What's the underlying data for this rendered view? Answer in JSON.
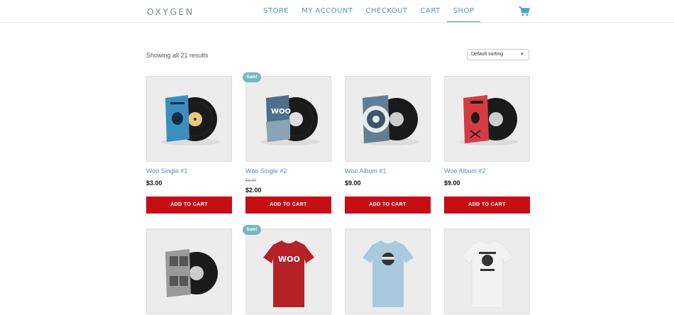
{
  "header": {
    "logo": "OXYGEN",
    "nav": [
      "STORE",
      "MY ACCOUNT",
      "CHECKOUT",
      "CART",
      "SHOP"
    ],
    "active_nav": "SHOP",
    "cart_icon": "shopping-cart-icon"
  },
  "shop": {
    "result_count": "Showing all 21 results",
    "sorting": {
      "selected": "Default sorting",
      "caret": "▼"
    }
  },
  "products": [
    {
      "name": "Woo Single #1",
      "price": "$3.00",
      "button": "ADD TO CART",
      "image": "vinyl-record-blue"
    },
    {
      "name": "Woo Single #2",
      "sale_badge": "Sale!",
      "old_price": "$3.00",
      "price": "$2.00",
      "button": "ADD TO CART",
      "image": "vinyl-record-woo"
    },
    {
      "name": "Woo Album #1",
      "price": "$9.00",
      "button": "ADD TO CART",
      "image": "vinyl-record-circle"
    },
    {
      "name": "Woo Album #2",
      "price": "$9.00",
      "button": "ADD TO CART",
      "image": "vinyl-record-red"
    },
    {
      "name": "",
      "image": "vinyl-record-gray"
    },
    {
      "name": "",
      "sale_badge": "Sale!",
      "image": "tshirt-red-woo"
    },
    {
      "name": "",
      "image": "tshirt-blue-ninja"
    },
    {
      "name": "",
      "image": "tshirt-white-woothemes"
    }
  ],
  "colors": {
    "accent": "#5a8fb0",
    "button": "#c70e15",
    "sale_badge": "#77b7c1"
  }
}
